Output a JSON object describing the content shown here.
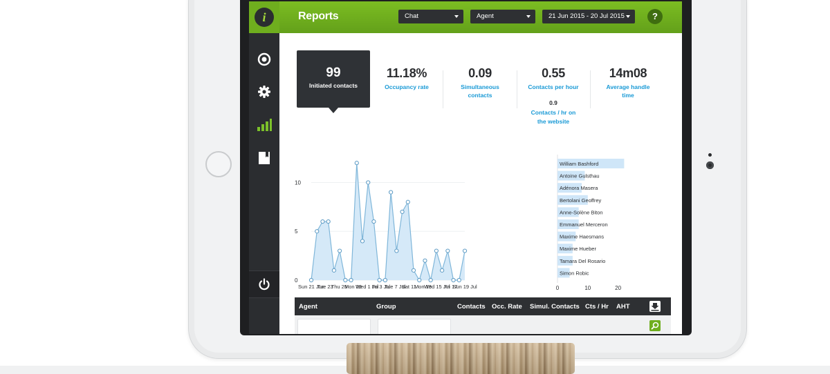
{
  "header": {
    "title": "Reports",
    "channel_dropdown": "Chat",
    "agent_dropdown": "Agent",
    "date_range": "21 Jun 2015 - 20 Jul 2015",
    "help_label": "?"
  },
  "sidebar": {
    "logo_letter": "i",
    "icons": [
      "dashboard-icon",
      "gear-icon",
      "bar-chart-icon",
      "book-icon"
    ],
    "bottom_icon": "power-icon"
  },
  "kpis": [
    {
      "value": "99",
      "label": "Initiated contacts"
    },
    {
      "value": "11.18%",
      "label": "Occupancy rate"
    },
    {
      "value": "0.09",
      "label_line1": "Simultaneous",
      "label_line2": "contacts"
    },
    {
      "value": "0.55",
      "label": "Contacts per hour",
      "sub_value": "0.9",
      "sub_label_line1": "Contacts / hr on",
      "sub_label_line2": "the website"
    },
    {
      "value": "14m08",
      "label_line1": "Average handle",
      "label_line2": "time"
    }
  ],
  "chart_data": [
    {
      "type": "area",
      "y_ticks": [
        "10",
        "5",
        "0"
      ],
      "ylim": [
        0,
        13
      ],
      "x_tick_labels": [
        "Sun 21 Jun",
        "Tue 23",
        "Thu 25",
        "Mon 29",
        "Wed 1 Jul",
        "Fri 3 Jul",
        "Tue 7 Jul",
        "Sat 11",
        "Mon 13",
        "Wed 15 Jul",
        "Fri 17",
        "Sun 19 Jul"
      ],
      "values": [
        0,
        5,
        6,
        6,
        1,
        3,
        0,
        0,
        12,
        4,
        10,
        6,
        0,
        0,
        9,
        3,
        7,
        8,
        1,
        0,
        2,
        0,
        3,
        1,
        3,
        0,
        0,
        3
      ],
      "colors": {
        "fill": "#d5e9f8",
        "line": "#7fb6d9",
        "point": "#5b9ac4"
      }
    },
    {
      "type": "bar",
      "orientation": "horizontal",
      "categories": [
        "William Bashford",
        "Antoine Gulsthau",
        "Adénora Masera",
        "Bertolani Geoffrey",
        "Anne-Solène Biton",
        "Emmanuel Merceron",
        "Maxime Haesmans",
        "Maxime Hueber",
        "Tamara Del Rosario",
        "Simon Robic"
      ],
      "values": [
        22,
        9,
        8,
        10,
        7,
        7,
        6,
        5,
        5,
        4
      ],
      "x_ticks": [
        "0",
        "10",
        "20"
      ],
      "xlim": [
        0,
        21
      ],
      "colors": {
        "bar": "#cfe6f8",
        "text": "#2b2d30"
      }
    }
  ],
  "table": {
    "columns": [
      "Agent",
      "Group",
      "Contacts",
      "Occ. Rate",
      "Simul. Contacts",
      "Cts / Hr",
      "AHT"
    ]
  }
}
